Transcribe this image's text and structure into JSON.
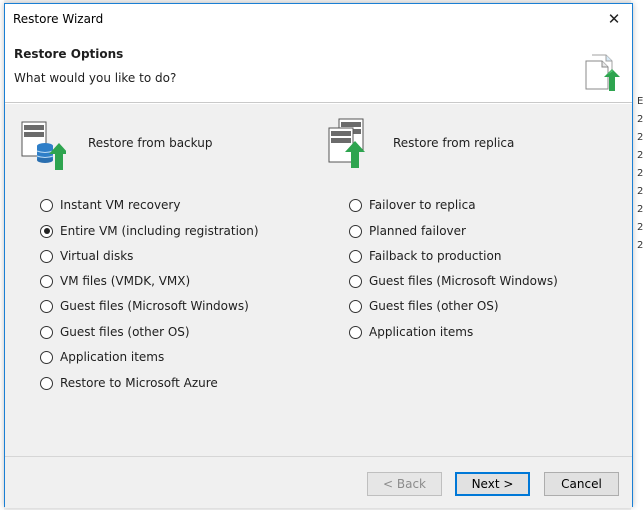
{
  "window": {
    "title": "Restore Wizard",
    "close_glyph": "✕"
  },
  "header": {
    "title": "Restore Options",
    "subtitle": "What would you like to do?",
    "icon": "document-restore-icon"
  },
  "backup_group": {
    "label": "Restore from backup",
    "icon": "server-database-restore-icon",
    "options": [
      {
        "label": "Instant VM recovery",
        "checked": false
      },
      {
        "label": "Entire VM (including registration)",
        "checked": true
      },
      {
        "label": "Virtual disks",
        "checked": false
      },
      {
        "label": "VM files (VMDK, VMX)",
        "checked": false
      },
      {
        "label": "Guest files (Microsoft Windows)",
        "checked": false
      },
      {
        "label": "Guest files (other OS)",
        "checked": false
      },
      {
        "label": "Application items",
        "checked": false
      },
      {
        "label": "Restore to Microsoft Azure",
        "checked": false
      }
    ]
  },
  "replica_group": {
    "label": "Restore from replica",
    "icon": "replica-restore-icon",
    "options": [
      {
        "label": "Failover to replica",
        "checked": false
      },
      {
        "label": "Planned failover",
        "checked": false
      },
      {
        "label": "Failback to production",
        "checked": false
      },
      {
        "label": "Guest files (Microsoft Windows)",
        "checked": false
      },
      {
        "label": "Guest files (other OS)",
        "checked": false
      },
      {
        "label": "Application items",
        "checked": false
      }
    ]
  },
  "footer": {
    "back_label": "< Back",
    "next_label": "Next >",
    "cancel_label": "Cancel"
  },
  "background": {
    "right_letters": [
      "E",
      "2",
      "2",
      "2",
      "2",
      "2",
      "2",
      "2",
      "2"
    ]
  },
  "colors": {
    "accent": "#0078d7",
    "arrow_green": "#2ea44f",
    "window_border": "#1a7fd4"
  }
}
